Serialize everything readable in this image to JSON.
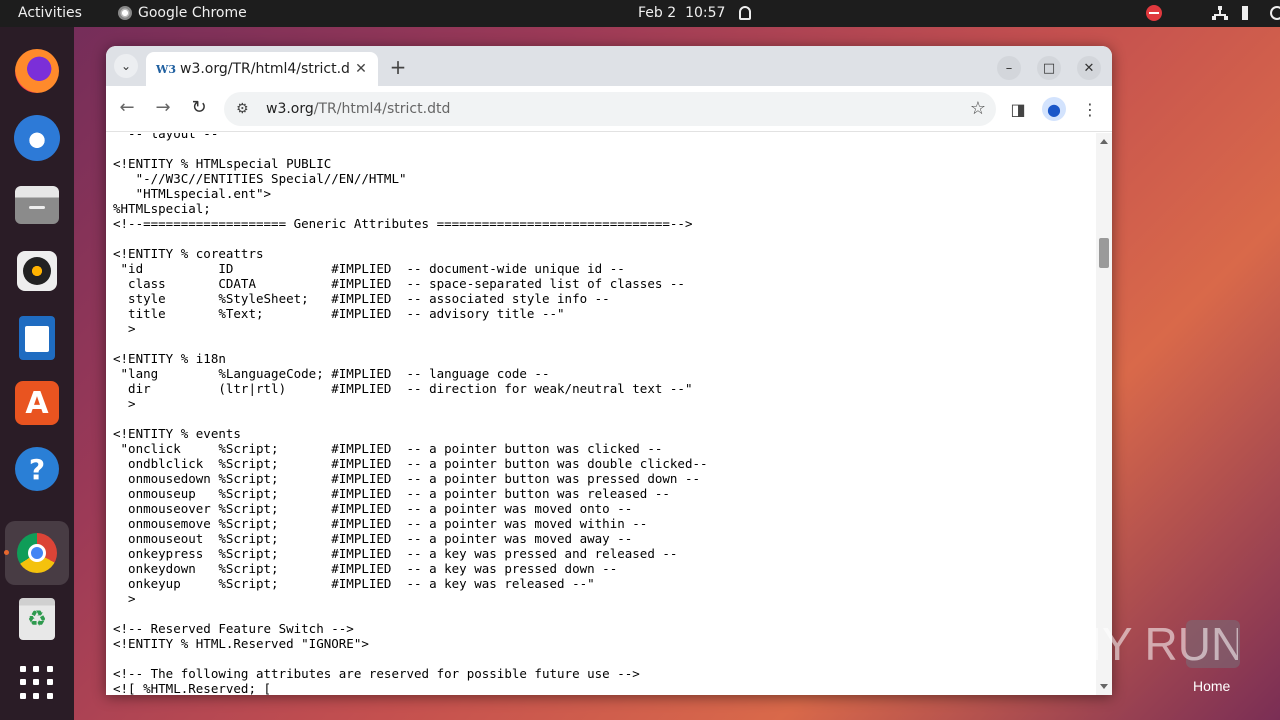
{
  "topbar": {
    "activities": "Activities",
    "app_name": "Google Chrome",
    "date": "Feb 2",
    "time": "10:57"
  },
  "browser": {
    "tab_title": "w3.org/TR/html4/strict.d",
    "tab_favicon": "W3",
    "url_host": "w3.org",
    "url_path": "/TR/html4/strict.dtd",
    "new_tab": "+",
    "close_tab": "✕"
  },
  "page": {
    "dtd_lines": "  -- layout --\n\n<!ENTITY % HTMLspecial PUBLIC\n   \"-//W3C//ENTITIES Special//EN//HTML\"\n   \"HTMLspecial.ent\">\n%HTMLspecial;\n<!--=================== Generic Attributes ===============================-->\n\n<!ENTITY % coreattrs\n \"id          ID             #IMPLIED  -- document-wide unique id --\n  class       CDATA          #IMPLIED  -- space-separated list of classes --\n  style       %StyleSheet;   #IMPLIED  -- associated style info --\n  title       %Text;         #IMPLIED  -- advisory title --\"\n  >\n\n<!ENTITY % i18n\n \"lang        %LanguageCode; #IMPLIED  -- language code --\n  dir         (ltr|rtl)      #IMPLIED  -- direction for weak/neutral text --\"\n  >\n\n<!ENTITY % events\n \"onclick     %Script;       #IMPLIED  -- a pointer button was clicked --\n  ondblclick  %Script;       #IMPLIED  -- a pointer button was double clicked--\n  onmousedown %Script;       #IMPLIED  -- a pointer button was pressed down --\n  onmouseup   %Script;       #IMPLIED  -- a pointer button was released --\n  onmouseover %Script;       #IMPLIED  -- a pointer was moved onto --\n  onmousemove %Script;       #IMPLIED  -- a pointer was moved within --\n  onmouseout  %Script;       #IMPLIED  -- a pointer was moved away --\n  onkeypress  %Script;       #IMPLIED  -- a key was pressed and released --\n  onkeydown   %Script;       #IMPLIED  -- a key was pressed down --\n  onkeyup     %Script;       #IMPLIED  -- a key was released --\"\n  >\n\n<!-- Reserved Feature Switch -->\n<!ENTITY % HTML.Reserved \"IGNORE\">\n\n<!-- The following attributes are reserved for possible future use -->\n<![ %HTML.Reserved; [\n<!ENTITY % reserved"
  },
  "desktop": {
    "home_label": "Home",
    "watermark": "ANY RUN"
  },
  "colors": {
    "dnd_red": "#e0393e",
    "ubuntu_orange": "#e95420",
    "dock_bg": "#2a1c26"
  }
}
